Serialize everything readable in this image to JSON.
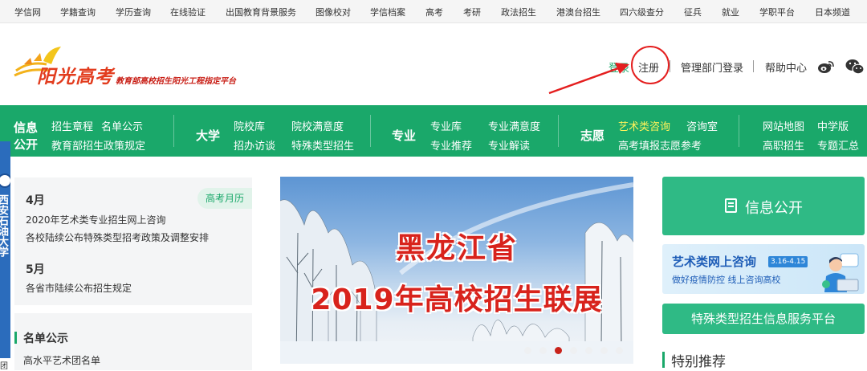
{
  "top_nav": [
    "学信网",
    "学籍查询",
    "学历查询",
    "在线验证",
    "出国教育背景服务",
    "图像校对",
    "学信档案",
    "高考",
    "考研",
    "政法招生",
    "港澳台招生",
    "四六级查分",
    "征兵",
    "就业",
    "学职平台",
    "日本频道"
  ],
  "logo": {
    "name": "阳光高考",
    "slogan": "教育部高校招生阳光工程指定平台"
  },
  "header_links": {
    "login": "登录",
    "register": "注册",
    "admin_login": "管理部门登录",
    "help": "帮助中心"
  },
  "main_nav": {
    "info": {
      "label_line1": "信息",
      "label_line2": "公开",
      "links": [
        "招生章程",
        "名单公示",
        "教育部招生政策规定"
      ]
    },
    "univ": {
      "label": "大学",
      "links": [
        "院校库",
        "院校满意度",
        "招办访谈",
        "特殊类型招生"
      ]
    },
    "major": {
      "label": "专业",
      "links": [
        "专业库",
        "专业满意度",
        "专业推荐",
        "专业解读"
      ]
    },
    "volunteer": {
      "label": "志愿",
      "links": [
        "艺术类咨询",
        "咨询室",
        "高考填报志愿参考"
      ]
    },
    "extra": [
      "网站地图",
      "中学版",
      "高职招生",
      "专题汇总"
    ]
  },
  "calendar": {
    "tag": "高考月历",
    "months": [
      {
        "month": "4月",
        "items": [
          "2020年艺术类专业招生网上咨询",
          "各校陆续公布特殊类型招考政策及调整安排"
        ]
      },
      {
        "month": "5月",
        "items": [
          "各省市陆续公布招生规定"
        ]
      }
    ]
  },
  "list_panel": {
    "title": "名单公示",
    "rows": [
      "高水平艺术团名单"
    ]
  },
  "banner": {
    "line1": "黑龙江省",
    "line2": "2019年高校招生联展",
    "dots_total": 7,
    "active_dot": 3
  },
  "right": {
    "info_button": "信息公开",
    "art_consult": {
      "title": "艺术类网上咨询",
      "dates": "3.16-4.15",
      "subtitle": "做好疫情防控  线上咨询高校"
    },
    "special_button": "特殊类型招生信息服务平台",
    "special_recommend": "特别推荐"
  },
  "left_strip_footer": "团",
  "left_strip_glyphs": "西安石油大学",
  "colors": {
    "brand_green": "#1aa86a",
    "button_green": "#2fba85",
    "hot_yellow": "#fff35a",
    "annotation_red": "#e41f1f"
  }
}
